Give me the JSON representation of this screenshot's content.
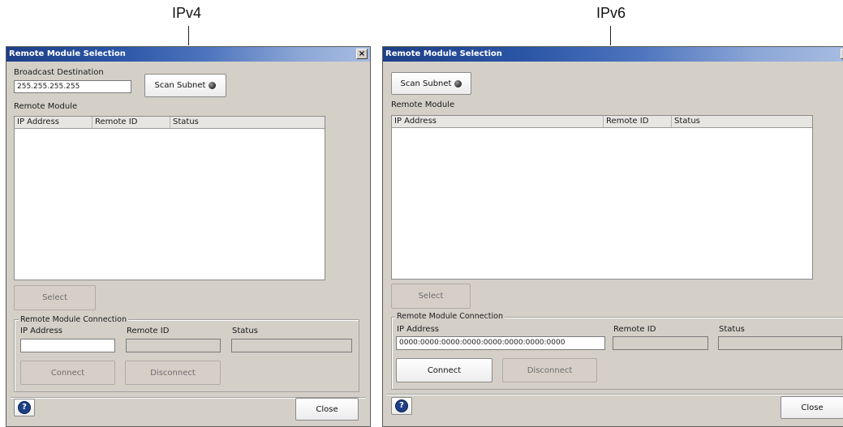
{
  "captions": {
    "left": "IPv4",
    "right": "IPv6"
  },
  "ipv4": {
    "title": "Remote Module Selection",
    "close_glyph": "×",
    "broadcast_label": "Broadcast Destination",
    "broadcast_value": "255.255.255.255",
    "scan_label": "Scan Subnet",
    "remote_module_label": "Remote Module",
    "columns": [
      "IP Address",
      "Remote ID",
      "Status"
    ],
    "select_label": "Select",
    "connection_group": "Remote Module Connection",
    "conn_ip_label": "IP Address",
    "conn_id_label": "Remote ID",
    "conn_status_label": "Status",
    "conn_ip_value": "",
    "connect_label": "Connect",
    "disconnect_label": "Disconnect",
    "close_label": "Close",
    "help_glyph": "?"
  },
  "ipv6": {
    "title": "Remote Module Selection",
    "close_glyph": "×",
    "scan_label": "Scan Subnet",
    "remote_module_label": "Remote Module",
    "columns": [
      "IP Address",
      "Remote ID",
      "Status"
    ],
    "select_label": "Select",
    "connection_group": "Remote Module Connection",
    "conn_ip_label": "IP Address",
    "conn_id_label": "Remote ID",
    "conn_status_label": "Status",
    "conn_ip_value": "0000:0000:0000:0000:0000:0000:0000:0000",
    "connect_label": "Connect",
    "disconnect_label": "Disconnect",
    "close_label": "Close",
    "help_glyph": "?"
  },
  "colors": {
    "title_gradient_start": "#1d3f86",
    "window_bg": "#d4d0c8",
    "disabled_button": "#d6cfc8"
  },
  "icons": {
    "led": "status-led-icon",
    "help": "help-icon",
    "close": "close-icon"
  }
}
